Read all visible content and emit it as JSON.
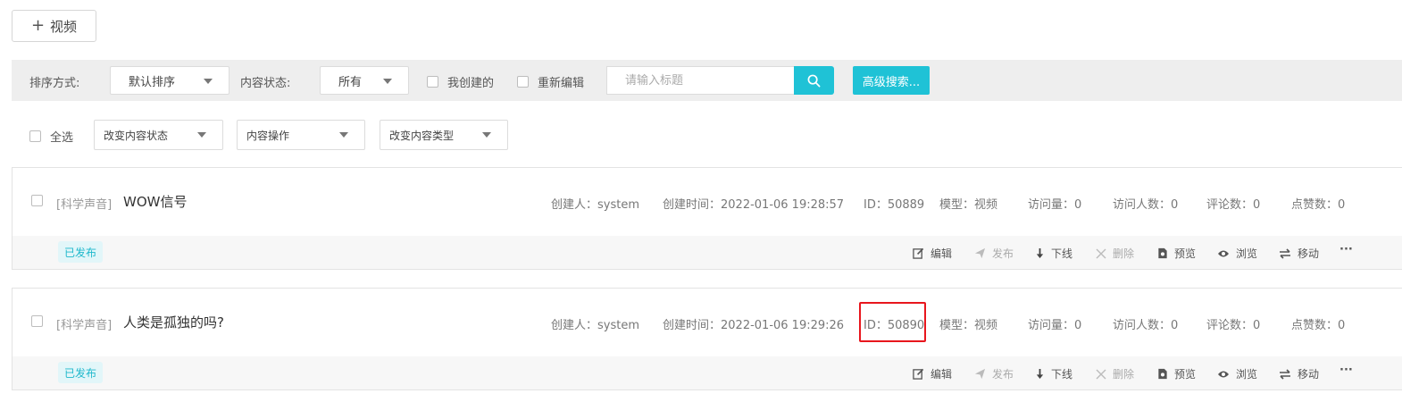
{
  "toolbar": {
    "add_label": "视频"
  },
  "filters": {
    "sort_label": "排序方式:",
    "sort_value": "默认排序",
    "status_label": "内容状态:",
    "status_value": "所有",
    "my_created": "我创建的",
    "re_edit": "重新编辑",
    "search_placeholder": "请输入标题",
    "advanced_label": "高级搜索..."
  },
  "batch": {
    "select_all": "全选",
    "change_status": "改变内容状态",
    "content_ops": "内容操作",
    "change_type": "改变内容类型"
  },
  "items": [
    {
      "category": "[科学声音]",
      "title": "WOW信号",
      "creator": "创建人：system",
      "created": "创建时间：2022-01-06 19:28:57",
      "id": "ID：50889",
      "model": "模型：视频",
      "visits": "访问量：0",
      "visitors": "访问人数：0",
      "comments": "评论数：0",
      "likes": "点赞数：0",
      "status": "已发布"
    },
    {
      "category": "[科学声音]",
      "title": "人类是孤独的吗?",
      "creator": "创建人：system",
      "created": "创建时间：2022-01-06 19:29:26",
      "id": "ID：50890",
      "model": "模型：视频",
      "visits": "访问量：0",
      "visitors": "访问人数：0",
      "comments": "评论数：0",
      "likes": "点赞数：0",
      "status": "已发布"
    }
  ],
  "actions": {
    "edit": "编辑",
    "publish": "发布",
    "offline": "下线",
    "delete": "删除",
    "preview": "预览",
    "browse": "浏览",
    "move": "移动",
    "more": "···"
  },
  "colors": {
    "accent": "#1fc2d6",
    "highlight": "#e8161d"
  }
}
